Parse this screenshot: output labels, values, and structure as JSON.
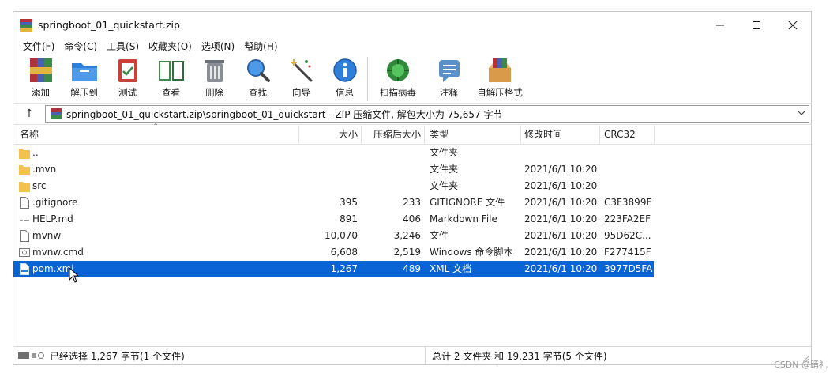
{
  "window": {
    "title": "springboot_01_quickstart.zip"
  },
  "menu": [
    "文件(F)",
    "命令(C)",
    "工具(S)",
    "收藏夹(O)",
    "选项(N)",
    "帮助(H)"
  ],
  "toolbar": {
    "add": "添加",
    "extract": "解压到",
    "test": "测试",
    "view": "查看",
    "delete": "删除",
    "find": "查找",
    "wizard": "向导",
    "info": "信息",
    "scan": "扫描病毒",
    "comment": "注释",
    "sfx": "自解压格式"
  },
  "address": {
    "up_symbol": "↑",
    "path": "springboot_01_quickstart.zip\\springboot_01_quickstart - ZIP 压缩文件, 解包大小为 75,657 字节"
  },
  "columns": {
    "name": "名称",
    "size": "大小",
    "packed": "压缩后大小",
    "type": "类型",
    "modified": "修改时间",
    "crc": "CRC32"
  },
  "files": [
    {
      "name": "..",
      "size": "",
      "packed": "",
      "type": "文件夹",
      "modified": "",
      "crc": "",
      "icon": "folder-icon"
    },
    {
      "name": ".mvn",
      "size": "",
      "packed": "",
      "type": "文件夹",
      "modified": "2021/6/1 10:20",
      "crc": "",
      "icon": "folder-icon"
    },
    {
      "name": "src",
      "size": "",
      "packed": "",
      "type": "文件夹",
      "modified": "2021/6/1 10:20",
      "crc": "",
      "icon": "folder-icon"
    },
    {
      "name": ".gitignore",
      "size": "395",
      "packed": "233",
      "type": "GITIGNORE 文件",
      "modified": "2021/6/1 10:20",
      "crc": "C3F3899F",
      "icon": "file-icon"
    },
    {
      "name": "HELP.md",
      "size": "891",
      "packed": "406",
      "type": "Markdown File",
      "modified": "2021/6/1 10:20",
      "crc": "223FA2EF",
      "icon": "markdown-icon"
    },
    {
      "name": "mvnw",
      "size": "10,070",
      "packed": "3,246",
      "type": "文件",
      "modified": "2021/6/1 10:20",
      "crc": "95D62C...",
      "icon": "file-icon"
    },
    {
      "name": "mvnw.cmd",
      "size": "6,608",
      "packed": "2,519",
      "type": "Windows 命令脚本",
      "modified": "2021/6/1 10:20",
      "crc": "F277415F",
      "icon": "script-icon"
    },
    {
      "name": "pom.xml",
      "size": "1,267",
      "packed": "489",
      "type": "XML 文档",
      "modified": "2021/6/1 10:20",
      "crc": "3977D5FA",
      "icon": "xml-icon",
      "selected": true
    }
  ],
  "status": {
    "left": "已经选择 1,267 字节(1 个文件)",
    "right": "总计 2 文件夹 和 19,231 字节(5 个文件)"
  },
  "watermark": "CSDN @踊礼",
  "colors": {
    "selection": "#0a64d6",
    "folder": "#f2c14e"
  }
}
